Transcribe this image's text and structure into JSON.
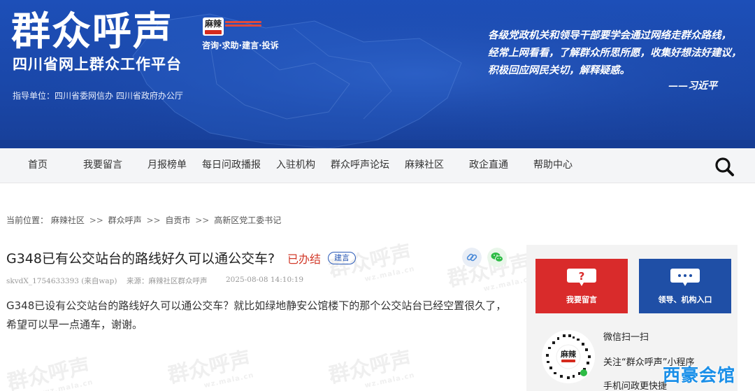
{
  "banner": {
    "title": "群众呼声",
    "subtitle": "四川省网上群众工作平台",
    "logo_text": "麻辣",
    "slogan": "咨询·求助·建言·投诉",
    "guidance": "指导单位：四川省委网信办  四川省政府办公厅",
    "quote_lines": [
      "各级党政机关和领导干部要学会通过网络走群众路线，",
      "经常上网看看，了解群众所思所愿，收集好想法好建议，",
      "积极回应网民关切，解释疑惑。"
    ],
    "quote_author": "——习近平"
  },
  "nav": {
    "items": [
      "首页",
      "我要留言",
      "月报榜单",
      "每日问政播报",
      "入驻机构",
      "群众呼声论坛",
      "麻辣社区",
      "政企直通",
      "帮助中心"
    ],
    "search_icon": "search-icon"
  },
  "breadcrumb": {
    "prefix": "当前位置：",
    "items": [
      "麻辣社区",
      "群众呼声",
      "自贡市",
      "高新区党工委书记"
    ],
    "separator": ">>"
  },
  "post": {
    "title": "G348已有公交站台的路线好久可以通公交车?",
    "status": "已办结",
    "type": "建言",
    "author": "skvdX_1754633393 (来自wap)",
    "source": "来源：麻辣社区群众呼声",
    "datetime": "2025-08-08 14:10:19",
    "body": "G348已设有公交站台的路线好久可以通公交车？就比如绿地静安公馆楼下的那个公交站台已经空置很久了，希望可以早一点通车，谢谢。",
    "share_icons": [
      "link-icon",
      "wechat-icon"
    ],
    "watermark_text": "群众呼声",
    "watermark_url": "wz.mala.cn"
  },
  "sidebar": {
    "leave_message_label": "我要留言",
    "leader_entry_label": "领导、机构入口",
    "qr_logo_text": "麻辣",
    "qr_lines": [
      "微信扫一扫",
      "关注“群众呼声”小程序",
      "手机问政更快捷"
    ]
  },
  "corner_watermark": "西豪会馆",
  "colors": {
    "banner_blue": "#1a47a8",
    "status_red": "#d23a2a",
    "badge_blue": "#2b5bb9",
    "card_red": "#d92b2b",
    "card_blue": "#1f4fa6"
  }
}
